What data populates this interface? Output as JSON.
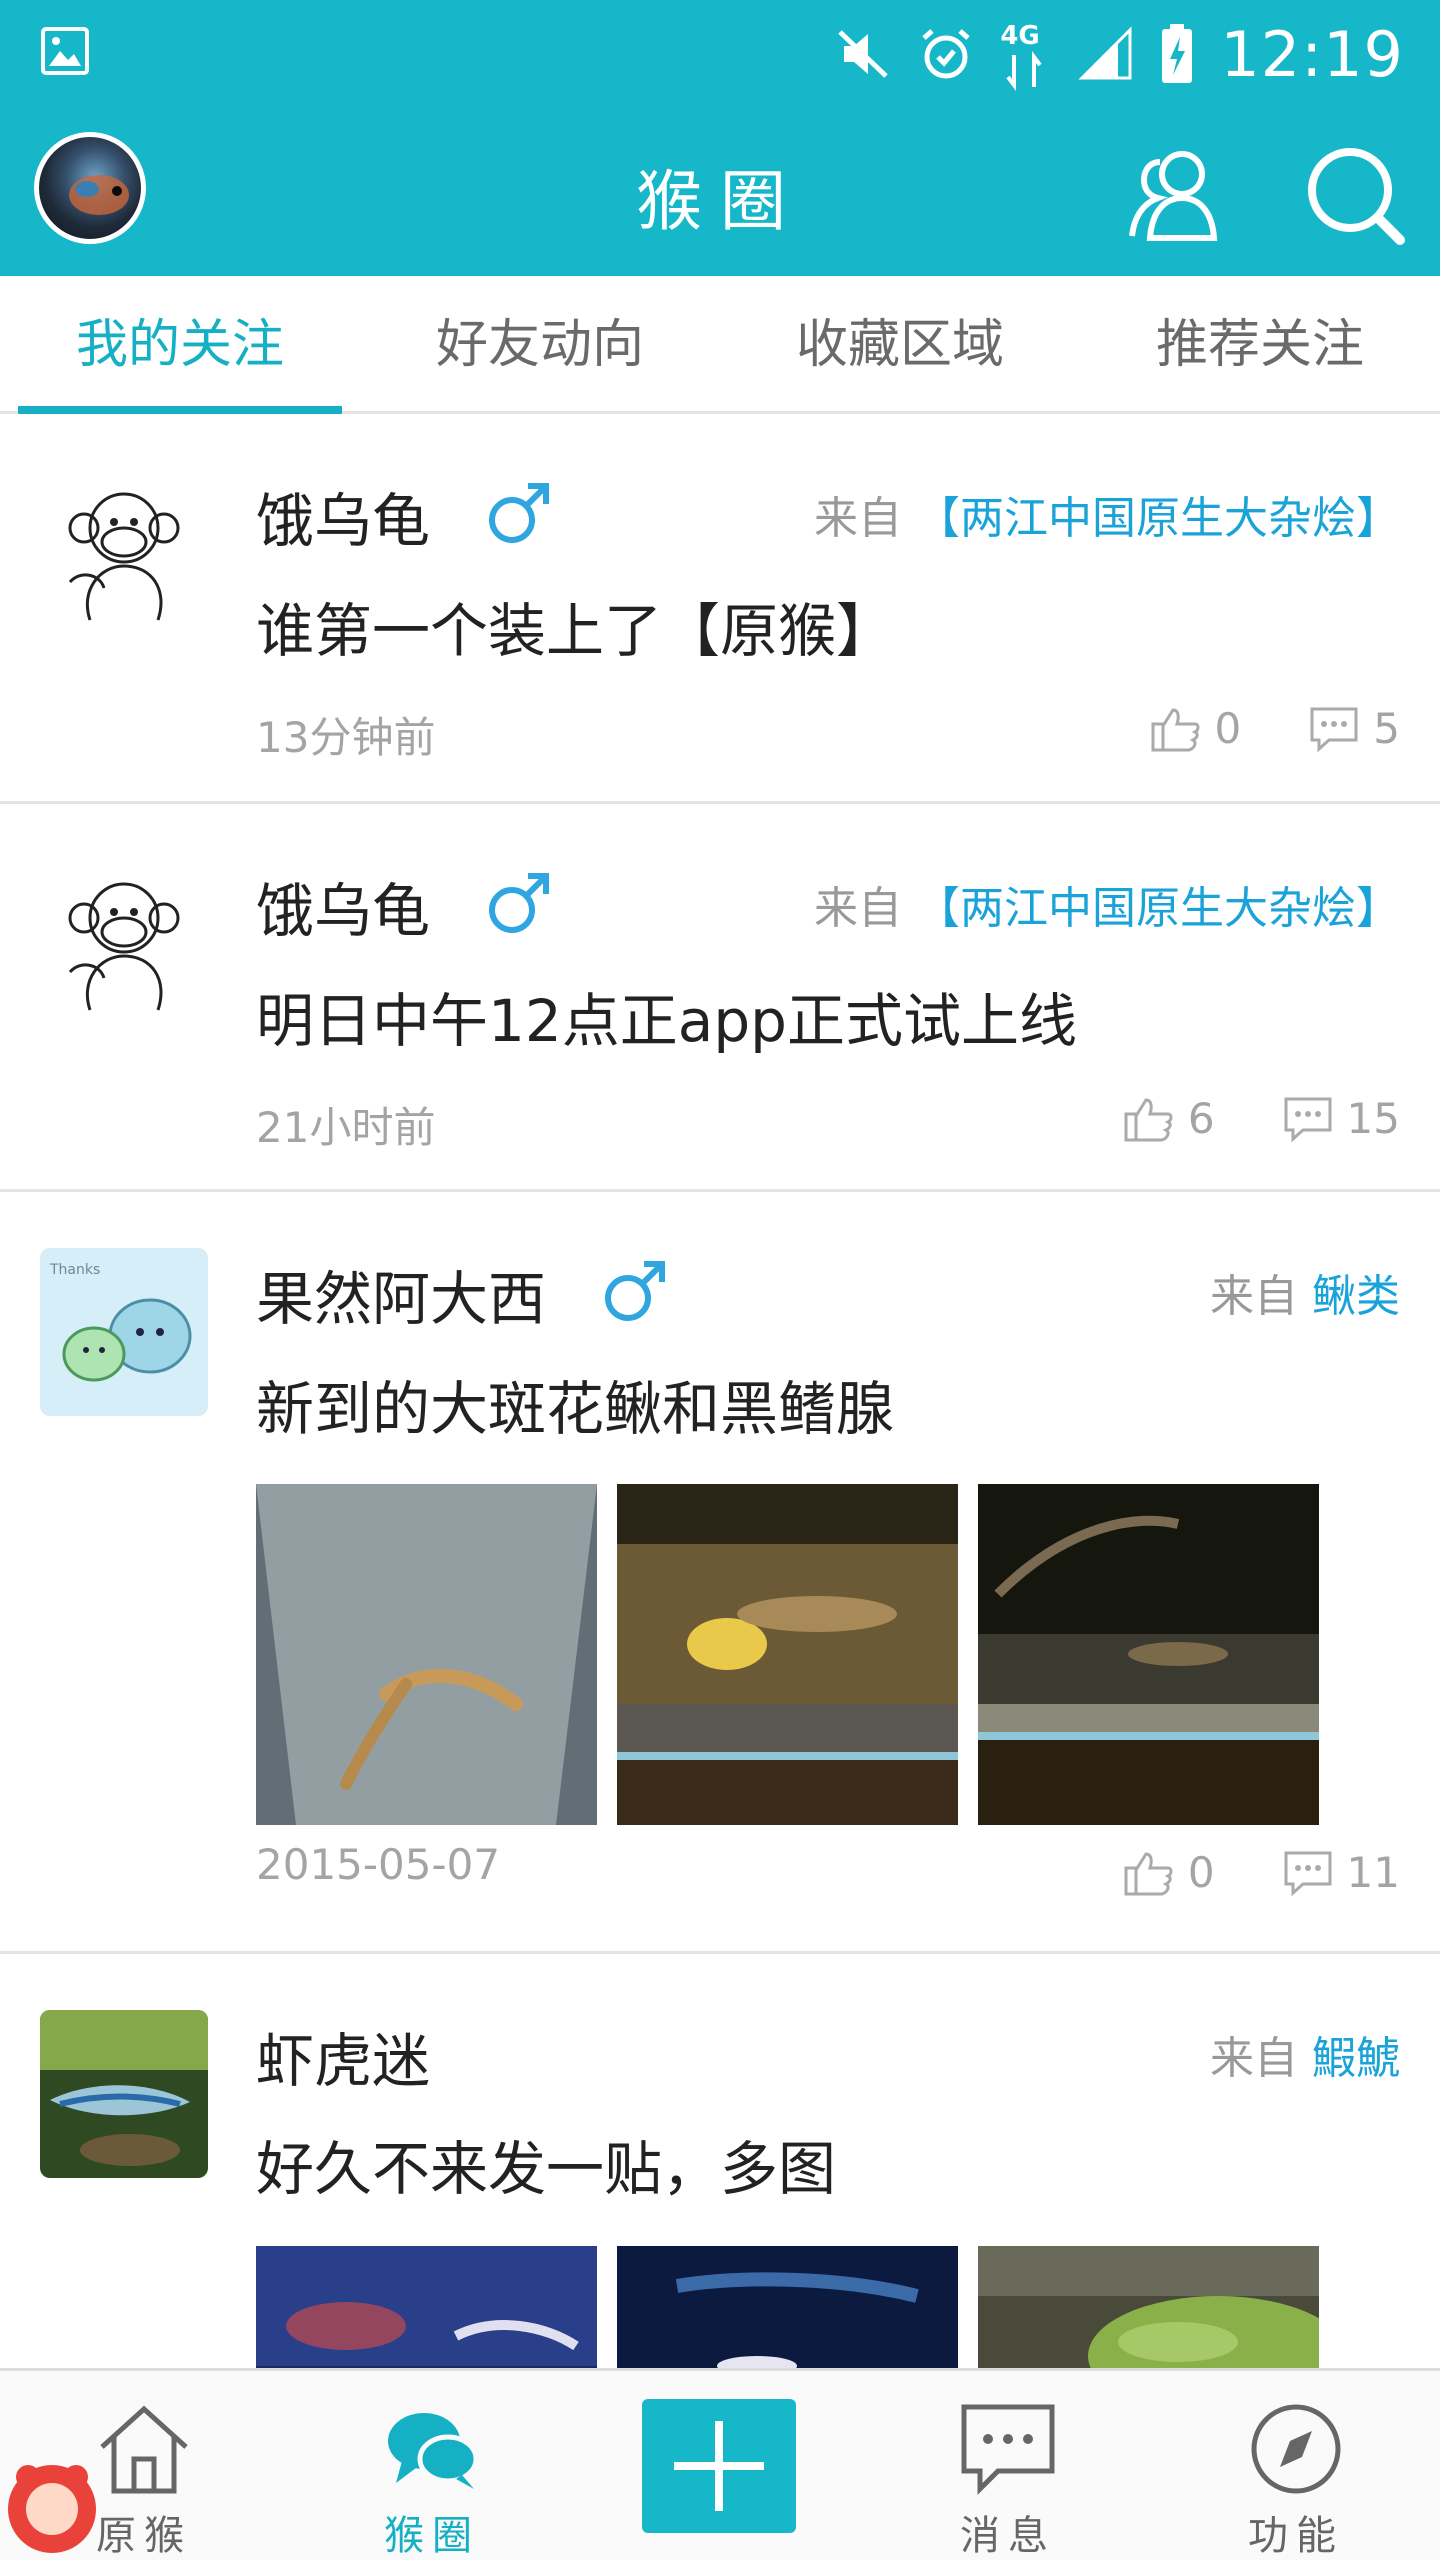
{
  "status_bar": {
    "time": "12:19",
    "network": "4G"
  },
  "header": {
    "title": "猴圈"
  },
  "tabs": [
    {
      "label": "我的关注",
      "active": true
    },
    {
      "label": "好友动向",
      "active": false
    },
    {
      "label": "收藏区域",
      "active": false
    },
    {
      "label": "推荐关注",
      "active": false
    }
  ],
  "posts": [
    {
      "name": "饿乌龟",
      "gender": "male",
      "from_label": "来自",
      "group": "【两江中国原生大杂烩】",
      "content": "谁第一个装上了【原猴】",
      "time": "13分钟前",
      "likes": "0",
      "comments": "5"
    },
    {
      "name": "饿乌龟",
      "gender": "male",
      "from_label": "来自",
      "group": "【两江中国原生大杂烩】",
      "content": "明日中午12点正app正式试上线",
      "time": "21小时前",
      "likes": "6",
      "comments": "15"
    },
    {
      "name": "果然阿大西",
      "gender": "male",
      "from_label": "来自",
      "group": "鳅类",
      "content": "新到的大斑花鳅和黑鳍腺",
      "time": "2015-05-07",
      "likes": "0",
      "comments": "11"
    },
    {
      "name": "虾虎迷",
      "gender": "",
      "from_label": "来自",
      "group": "鰕鯱",
      "content": "好久不来发一贴，多图"
    }
  ],
  "bottom_nav": [
    {
      "label": "原猴",
      "icon": "home-icon",
      "active": false
    },
    {
      "label": "猴圈",
      "icon": "chat-bubbles-icon",
      "active": true
    },
    {
      "label": "",
      "icon": "plus-icon",
      "active": false
    },
    {
      "label": "消息",
      "icon": "message-icon",
      "active": false
    },
    {
      "label": "功能",
      "icon": "compass-icon",
      "active": false
    }
  ],
  "colors": {
    "primary": "#16b7c9",
    "link": "#1aa3d8",
    "text": "#222222",
    "muted": "#a4a4a4"
  }
}
